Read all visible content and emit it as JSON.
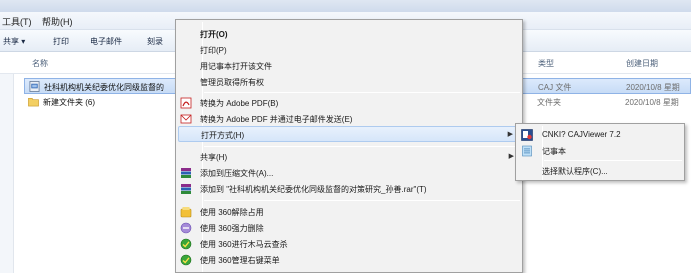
{
  "menubar": {
    "tools": "工具(T)",
    "help": "帮助(H)"
  },
  "toolbar": {
    "share": "共享 ▾",
    "print": "打印",
    "email": "电子邮件",
    "burn": "刻录"
  },
  "columns": {
    "name": "名称",
    "type": "类型",
    "date": "创建日期"
  },
  "files": [
    {
      "name": "社科机构机关纪委优化同级监督的",
      "type": "CAJ 文件",
      "date": "2020/10/8 星期"
    },
    {
      "name": "新建文件夹 (6)",
      "type": "文件夹",
      "date": "2020/10/8 星期"
    }
  ],
  "context_menu": {
    "open": "打开(O)",
    "print": "打印(P)",
    "open_notepad": "用记事本打开该文件",
    "take_ownership": "管理员取得所有权",
    "convert_pdf": "转换为 Adobe PDF(B)",
    "convert_pdf_email": "转换为 Adobe PDF 并通过电子邮件发送(E)",
    "open_with": "打开方式(H)",
    "share": "共享(H)",
    "add_archive": "添加到压缩文件(A)...",
    "add_rar": "添加到 \"社科机构机关纪委优化同级监督的对策研究_孙善.rar\"(T)",
    "unlock_360": "使用 360解除占用",
    "force_delete_360": "使用 360强力删除",
    "trojan_scan_360": "使用 360进行木马云查杀",
    "manage_menu_360": "使用 360管理右键菜单"
  },
  "submenu": {
    "cajviewer": "CNKI? CAJViewer 7.2",
    "notepad": "记事本",
    "choose_default": "选择默认程序(C)..."
  },
  "colors": {
    "selection": "#c7dcf6",
    "menu_bg": "#f2f2f2",
    "highlight_border": "#aecbef"
  }
}
